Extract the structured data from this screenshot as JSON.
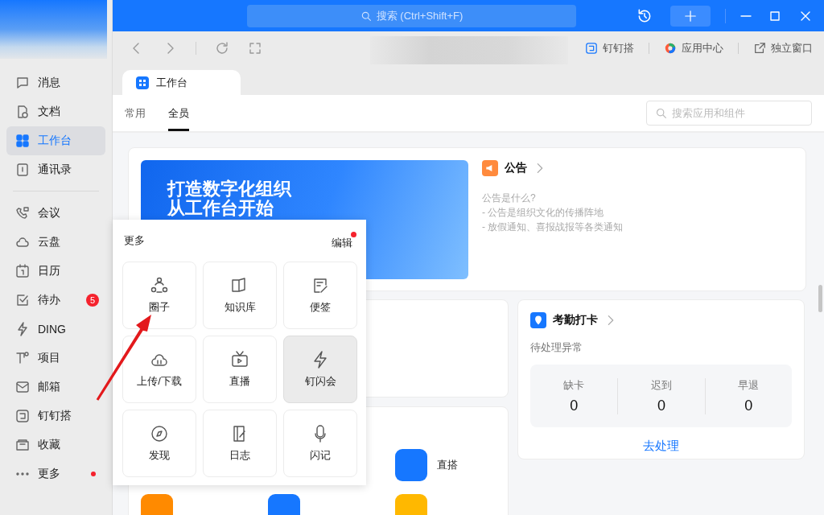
{
  "title_bar": {
    "search": {
      "placeholder": "搜索 (Ctrl+Shift+F)"
    }
  },
  "sidebar": {
    "items": [
      {
        "label": "消息",
        "selected": false
      },
      {
        "label": "文档",
        "selected": false
      },
      {
        "label": "工作台",
        "selected": true
      },
      {
        "label": "通讯录",
        "selected": false
      },
      {
        "label": "会议",
        "selected": false
      },
      {
        "label": "云盘",
        "selected": false
      },
      {
        "label": "日历",
        "selected": false
      },
      {
        "label": "待办",
        "selected": false,
        "badge": "5"
      },
      {
        "label": "DING",
        "selected": false
      },
      {
        "label": "项目",
        "selected": false
      },
      {
        "label": "邮箱",
        "selected": false
      },
      {
        "label": "钉钉搭",
        "selected": false
      },
      {
        "label": "收藏",
        "selected": false
      },
      {
        "label": "更多",
        "selected": false,
        "dot": true
      }
    ]
  },
  "toolbar": {
    "links": [
      "钉钉搭",
      "应用中心",
      "独立窗口"
    ]
  },
  "page_tab": {
    "label": "工作台"
  },
  "tabs": [
    {
      "label": "常用",
      "selected": false
    },
    {
      "label": "全员",
      "selected": true
    }
  ],
  "search": {
    "placeholder": "搜索应用和组件"
  },
  "banner": {
    "lines": [
      "打造数字化组织",
      "从工作台开始"
    ]
  },
  "notice": {
    "title": "公告",
    "lines": [
      "公告是什么?",
      "- 公告是组织文化的传播阵地",
      "- 放假通知、喜报战报等各类通知"
    ]
  },
  "attendance": {
    "title": "考勤打卡",
    "subtitle": "待处理异常",
    "stats": [
      {
        "label": "缺卡",
        "value": "0"
      },
      {
        "label": "迟到",
        "value": "0"
      },
      {
        "label": "早退",
        "value": "0"
      }
    ],
    "action": "去处理"
  },
  "apps": [
    {
      "label": "直搭",
      "color": "#1677ff"
    },
    {
      "color": "#ff8a00"
    },
    {
      "color": "#1677ff"
    },
    {
      "color": "#ffb800"
    }
  ],
  "more_popup": {
    "title": "更多",
    "edit": "编辑",
    "edit_dot": true,
    "items": [
      {
        "label": "圈子",
        "hovered": false
      },
      {
        "label": "知识库",
        "hovered": false
      },
      {
        "label": "便签",
        "hovered": false
      },
      {
        "label": "上传/下载",
        "hovered": false
      },
      {
        "label": "直播",
        "hovered": false
      },
      {
        "label": "钉闪会",
        "hovered": true
      },
      {
        "label": "发现",
        "hovered": false
      },
      {
        "label": "日志",
        "hovered": false
      },
      {
        "label": "闪记",
        "hovered": false
      }
    ]
  }
}
